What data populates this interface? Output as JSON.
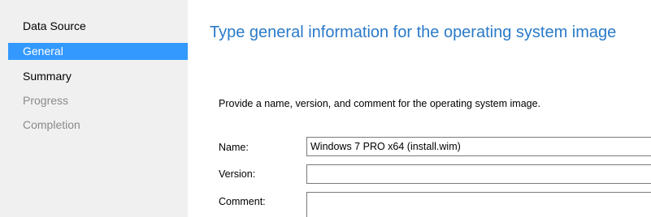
{
  "sidebar": {
    "items": [
      {
        "label": "Data Source"
      },
      {
        "label": "General"
      },
      {
        "label": "Summary"
      },
      {
        "label": "Progress"
      },
      {
        "label": "Completion"
      }
    ]
  },
  "main": {
    "heading": "Type general information for the operating system image",
    "description": "Provide a name, version, and comment for the operating system image.",
    "fields": {
      "name": {
        "label": "Name:",
        "value": "Windows 7 PRO x64 (install.wim)"
      },
      "version": {
        "label": "Version:",
        "value": ""
      },
      "comment": {
        "label": "Comment:",
        "value": ""
      }
    }
  },
  "colors": {
    "accent": "#3399ff",
    "heading": "#2a7ac8",
    "sidebar_bg": "#f0f0f0",
    "disabled_text": "#8a8a8a"
  }
}
